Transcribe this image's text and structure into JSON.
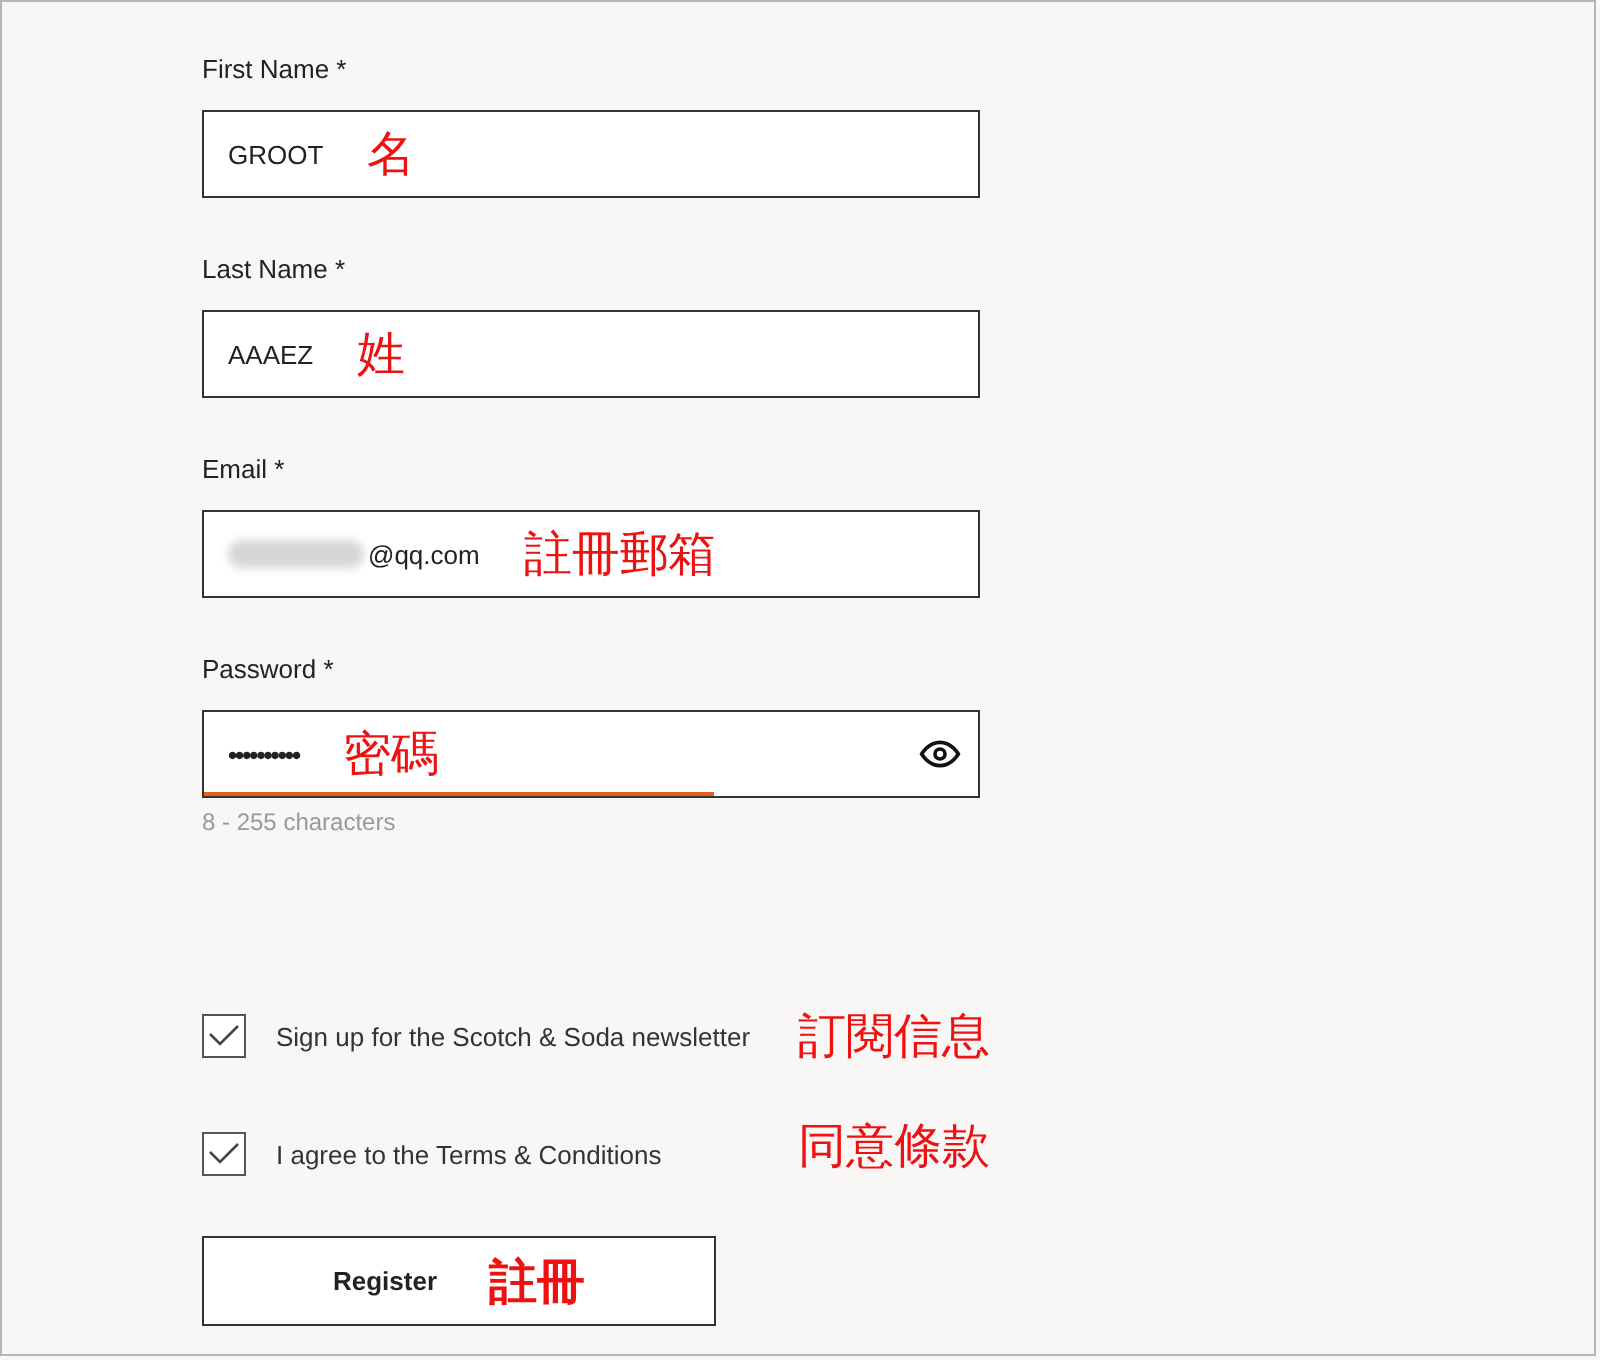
{
  "fields": [
    {
      "kind": "text",
      "label": "First Name *",
      "value": "GROOT",
      "annotation": "名"
    },
    {
      "kind": "text",
      "label": "Last Name *",
      "value": "AAAEZ",
      "annotation": "姓"
    },
    {
      "kind": "email",
      "label": "Email *",
      "value": "@qq.com",
      "redacted": true,
      "annotation": "註冊郵箱"
    },
    {
      "kind": "password",
      "label": "Password *",
      "value": "••••••••••",
      "annotation": "密碼",
      "strength": {
        "level": 0.66
      },
      "hint": "8 - 255 characters"
    }
  ],
  "checkboxes": [
    {
      "label": "Sign up for the Scotch & Soda newsletter",
      "checked": true,
      "annotation": "訂閱信息"
    },
    {
      "label": "I agree to the Terms & Conditions",
      "checked": true,
      "annotation": "同意條款"
    }
  ],
  "register": {
    "label": "Register",
    "annotation": "註冊"
  }
}
